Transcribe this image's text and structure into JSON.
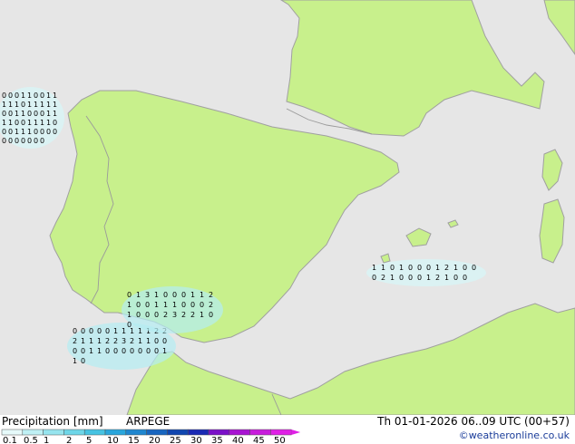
{
  "title": "Precipitation [mm]",
  "model": "ARPEGE",
  "valid_time": "Th 01-01-2026 06..09 UTC (00+57)",
  "credit": "©weatheronline.co.uk",
  "colors": {
    "sea": "#e6e6e6",
    "land": "#c8f08c",
    "coast": "#a0a0a0",
    "border": "#9a9a9a",
    "marker": "#000000"
  },
  "legend": {
    "labels": [
      "0.1",
      "0.5",
      "1",
      "2",
      "5",
      "10",
      "15",
      "20",
      "25",
      "30",
      "35",
      "40",
      "45",
      "50"
    ],
    "colors": [
      "#e6fafa",
      "#bff0f4",
      "#96e4ee",
      "#6ed6e8",
      "#46c3e2",
      "#2aa6dc",
      "#1f86cf",
      "#1866c0",
      "#1046b0",
      "#1a2ab4",
      "#7a10c8",
      "#a814d2",
      "#c81cdc",
      "#e020e6"
    ]
  },
  "precip_clusters": [
    {
      "id": "atlantic-w",
      "intensity": 1,
      "markers": [
        "0",
        "0",
        "0",
        "1",
        "1",
        "0",
        "0",
        "1",
        "1",
        "1",
        "1",
        "1",
        "0",
        "1",
        "1",
        "1",
        "1",
        "1",
        "0",
        "0",
        "1",
        "1",
        "0",
        "0",
        "0",
        "1",
        "1",
        "1",
        "1",
        "0",
        "0",
        "1",
        "1",
        "1",
        "1",
        "0",
        "0",
        "0",
        "1",
        "1",
        "1",
        "0",
        "0",
        "0",
        "0",
        "0",
        "0",
        "0",
        "0",
        "0",
        "0",
        "0"
      ]
    },
    {
      "id": "gulf-cadiz",
      "intensity": 2,
      "markers": [
        "0",
        "0",
        "0",
        "0",
        "0",
        "1",
        "1",
        "1",
        "1",
        "1",
        "2",
        "2",
        "2",
        "1",
        "1",
        "1",
        "2",
        "2",
        "3",
        "2",
        "1",
        "1",
        "0",
        "0",
        "0",
        "0",
        "1",
        "1",
        "0",
        "0",
        "0",
        "0",
        "0",
        "0",
        "0",
        "1",
        "1",
        "0"
      ]
    },
    {
      "id": "alboran",
      "intensity": 2,
      "markers": [
        "0",
        "1",
        "3",
        "1",
        "0",
        "0",
        "0",
        "1",
        "1",
        "2",
        "1",
        "0",
        "0",
        "1",
        "1",
        "1",
        "0",
        "0",
        "0",
        "2",
        "1",
        "0",
        "0",
        "0",
        "2",
        "3",
        "2",
        "2",
        "1",
        "0",
        "0"
      ]
    },
    {
      "id": "balearic",
      "intensity": 1,
      "markers": [
        "1",
        "1",
        "0",
        "1",
        "0",
        "0",
        "0",
        "1",
        "2",
        "1",
        "0",
        "0",
        "0",
        "2",
        "1",
        "0",
        "0",
        "0",
        "1",
        "2",
        "1",
        "0",
        "0"
      ]
    }
  ]
}
